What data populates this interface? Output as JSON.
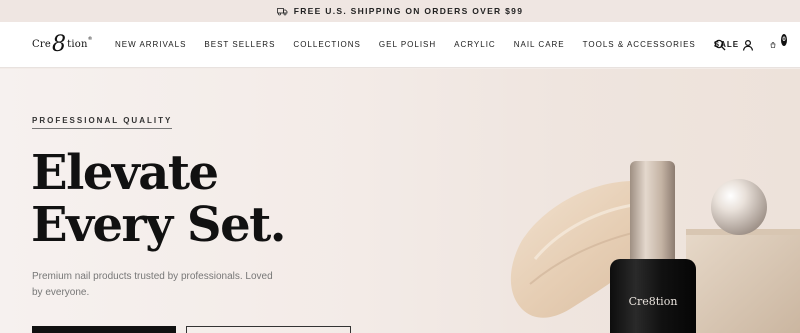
{
  "announcement": {
    "icon": "truck-icon",
    "text": "FREE U.S. SHIPPING ON ORDERS OVER $99"
  },
  "header": {
    "logo": {
      "left": "Cre",
      "mid": "8",
      "right": "tion",
      "mark": "®"
    },
    "nav": [
      {
        "label": "NEW ARRIVALS"
      },
      {
        "label": "BEST SELLERS"
      },
      {
        "label": "COLLECTIONS"
      },
      {
        "label": "GEL POLISH"
      },
      {
        "label": "ACRYLIC"
      },
      {
        "label": "NAIL CARE"
      },
      {
        "label": "TOOLS & ACCESSORIES"
      },
      {
        "label": "SALE"
      }
    ],
    "icons": [
      "search-icon",
      "account-icon",
      "cart-icon"
    ],
    "cart_count": "0"
  },
  "hero": {
    "eyebrow": "PROFESSIONAL QUALITY",
    "headline_line1": "Elevate",
    "headline_line2": "Every Set.",
    "subtext": "Premium nail products trusted by professionals. Loved by everyone.",
    "bottle_logo": "Cre8tion"
  },
  "colors": {
    "background": "#f3ece8",
    "text": "#111111",
    "bottle": "#151515",
    "cap": "#c9b8a8"
  }
}
